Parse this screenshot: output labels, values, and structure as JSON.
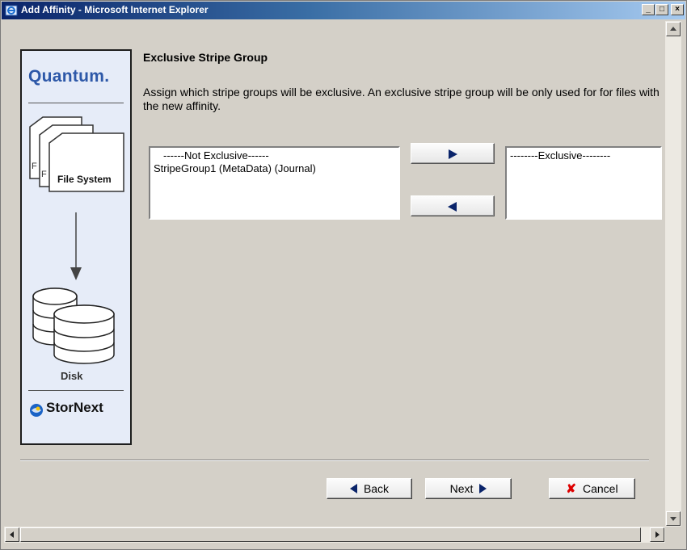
{
  "window": {
    "title": "Add Affinity - Microsoft Internet Explorer",
    "controls": {
      "minimize": "_",
      "maximize": "□",
      "close": "×"
    }
  },
  "sidebar": {
    "logo": "Quantum.",
    "file_system_label": "File System",
    "disk_label": "Disk",
    "brand": "StorNext"
  },
  "main": {
    "heading": "Exclusive Stripe Group",
    "description": "Assign which stripe groups will be exclusive. An exclusive stripe group will be only used for for files with the new affinity.",
    "not_exclusive_list": [
      "------Not Exclusive------",
      "StripeGroup1 (MetaData)  (Journal)"
    ],
    "exclusive_list": [
      "--------Exclusive--------"
    ]
  },
  "footer": {
    "back_label": "Back",
    "next_label": "Next",
    "cancel_label": "Cancel"
  },
  "colors": {
    "accent": "#0a246a",
    "logo": "#2d58a8",
    "cancel_x": "#dd0000"
  }
}
